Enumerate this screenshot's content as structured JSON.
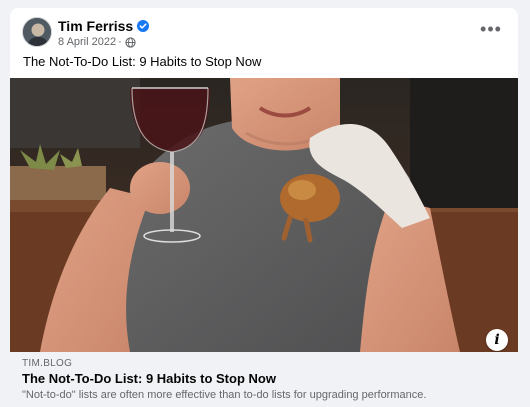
{
  "post": {
    "author": "Tim Ferriss",
    "date": "8 April 2022",
    "separator": "·",
    "more_label": "•••",
    "caption": "The Not-To-Do List: 9 Habits to Stop Now",
    "info_label": "i",
    "link": {
      "domain": "TIM.BLOG",
      "title": "The Not-To-Do List: 9 Habits to Stop Now",
      "description": "\"Not-to-do\" lists are often more effective than to-do lists for upgrading performance."
    }
  },
  "colors": {
    "verified": "#1877f2",
    "secondary_text": "#65676b",
    "preview_bg": "#f0f2f5"
  },
  "icons": [
    "verified-badge-icon",
    "globe-icon",
    "more-options-icon",
    "info-icon"
  ]
}
